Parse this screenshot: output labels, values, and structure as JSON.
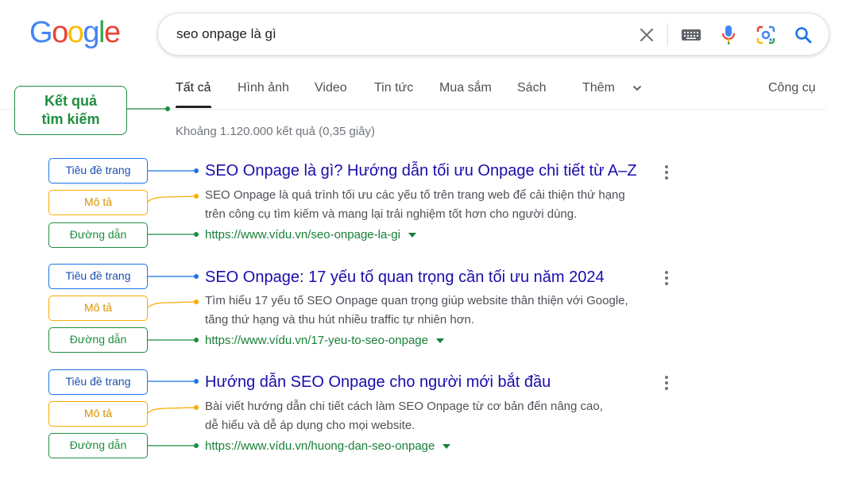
{
  "logo": {
    "letters": [
      "G",
      "o",
      "o",
      "g",
      "l",
      "e"
    ],
    "colors": [
      "#4285F4",
      "#EA4335",
      "#FBBC05",
      "#4285F4",
      "#34A853",
      "#EA4335"
    ]
  },
  "search": {
    "query": "seo onpage là gì",
    "icons": [
      "close-icon",
      "keyboard-icon",
      "microphone-icon",
      "lens-icon",
      "search-icon"
    ]
  },
  "tabs": [
    {
      "label": "Tất cả",
      "active": true
    },
    {
      "label": "Hình ảnh"
    },
    {
      "label": "Video"
    },
    {
      "label": "Tin tức"
    },
    {
      "label": "Mua sắm"
    },
    {
      "label": "Sách"
    },
    {
      "label": "Thêm"
    }
  ],
  "tools_label": "Công cụ",
  "stats": "Khoảng 1.120.000 kết quả (0,35 giây)",
  "callout": {
    "line1": "Kết quả",
    "line2": "tìm kiếm"
  },
  "labels": {
    "title": "Tiêu đề trang",
    "desc": "Mô tả",
    "url": "Đường dẫn"
  },
  "results": [
    {
      "title": "SEO Onpage là gì? Hướng dẫn tối ưu Onpage chi tiết từ A–Z",
      "desc1": "SEO Onpage là quá trình tối ưu các yếu tố trên trang web để cải thiện thứ hạng",
      "desc2": "trên công cụ tìm kiếm và mang lại trải nghiệm tốt hơn cho người dùng.",
      "url": "https://www.vídu.vn/seo-onpage-la-gi"
    },
    {
      "title": "SEO Onpage: 17 yếu tố quan trọng cần tối ưu năm 2024",
      "desc1": "Tìm hiểu 17 yếu tố SEO Onpage quan trọng giúp website thân thiện với Google,",
      "desc2": "tăng thứ hạng và thu hút nhiều traffic tự nhiên hơn.",
      "url": "https://www.vídu.vn/17-yeu-to-seo-onpage"
    },
    {
      "title": "Hướng dẫn SEO Onpage cho người mới bắt đầu",
      "desc1": "Bài viết hướng dẫn chi tiết cách làm SEO Onpage từ cơ bản đến nâng cao,",
      "desc2": "dễ hiểu và dễ áp dụng cho mọi website.",
      "url": "https://www.vídu.vn/huong-dan-seo-onpage"
    }
  ],
  "colors": {
    "title_blue": "#1a0dab",
    "url_green": "#188038",
    "annotation_blue": "#1a73e8",
    "annotation_yellow": "#f9ab00",
    "annotation_green": "#1e8e3e"
  }
}
